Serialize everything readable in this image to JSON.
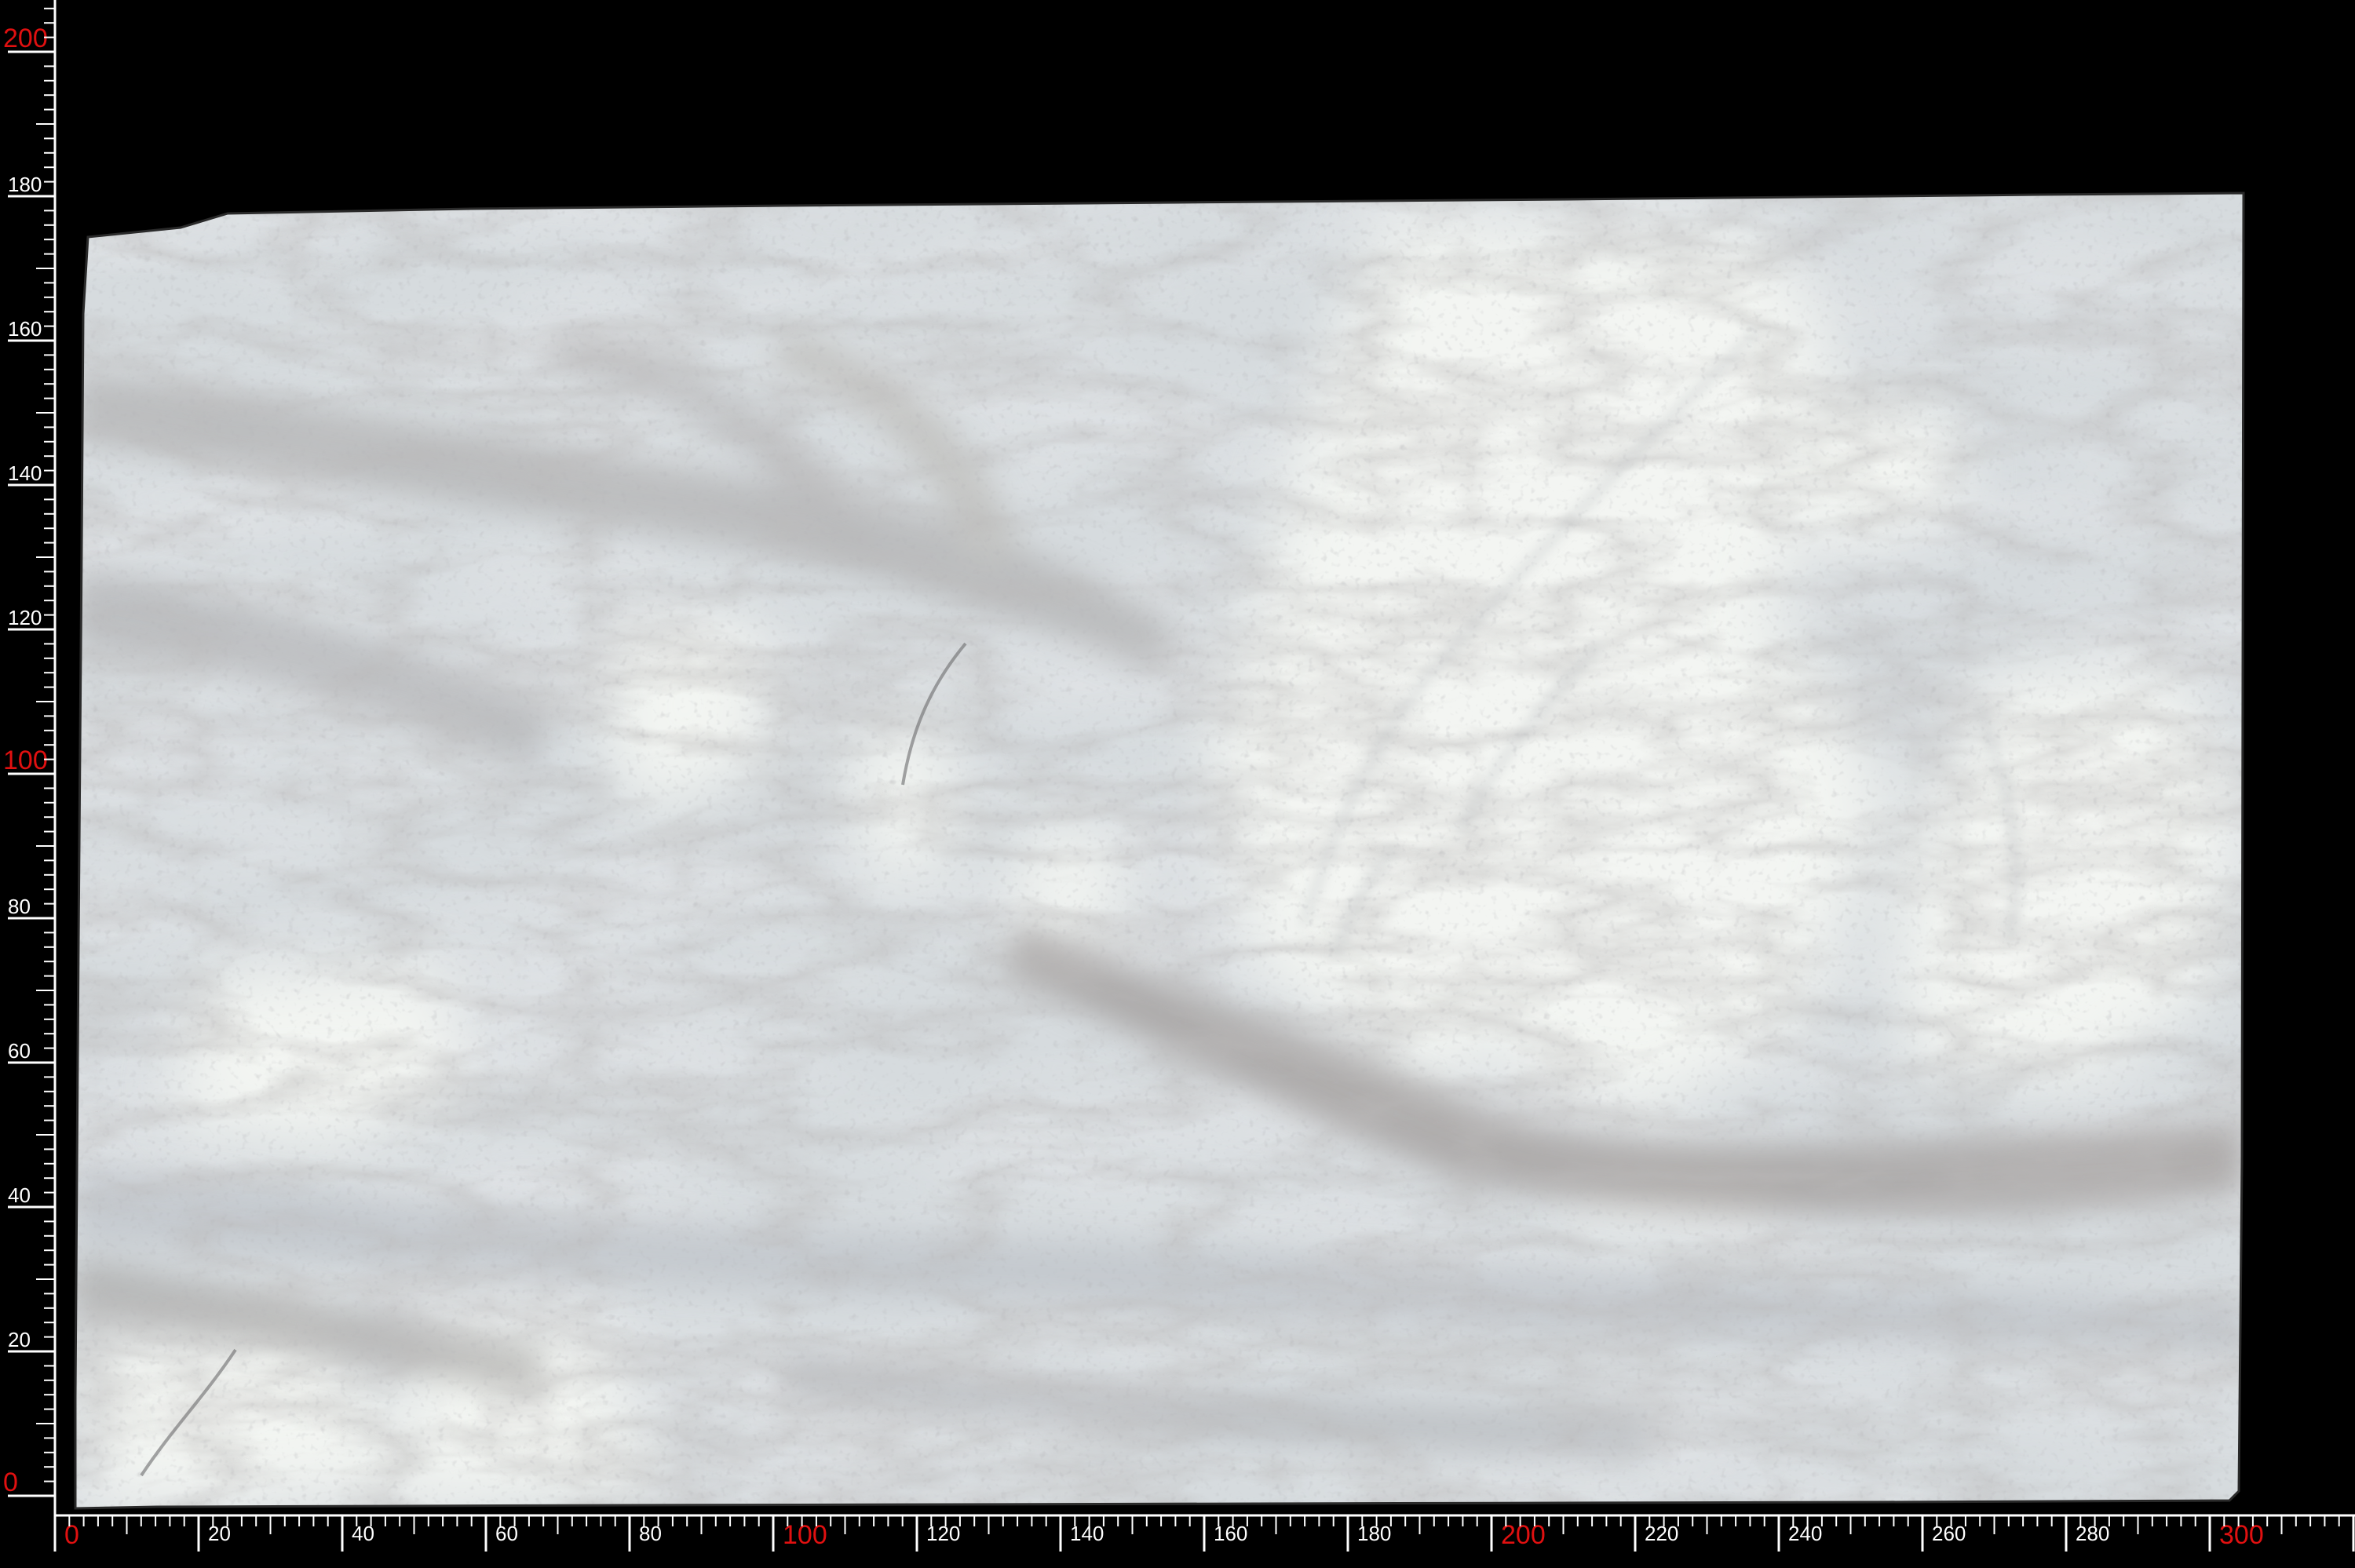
{
  "colors": {
    "background": "#000000",
    "ruler_line": "#ffffff",
    "minor_label": "#ffffff",
    "major_label": "#e01010",
    "stone_base": "#d7dcdf",
    "stone_white": "#f4f6f3",
    "vein_gray": "#9a9a9c",
    "vein_brown": "#8f8784"
  },
  "image": {
    "subject": "marble-slab",
    "shows_grey_brown_veins": true
  },
  "rulers": {
    "x": {
      "min": 0,
      "max": 300,
      "minor_step": 2,
      "label_step": 20,
      "major_values": [
        0,
        100,
        200,
        300
      ],
      "labels": [
        "0",
        "20",
        "40",
        "60",
        "80",
        "100",
        "120",
        "140",
        "160",
        "180",
        "200",
        "220",
        "240",
        "260",
        "280",
        "300"
      ]
    },
    "y": {
      "min": 0,
      "max": 200,
      "minor_step": 2,
      "label_step": 20,
      "major_values": [
        0,
        100,
        200
      ],
      "labels": [
        "0",
        "20",
        "40",
        "60",
        "80",
        "100",
        "120",
        "140",
        "160",
        "180",
        "200"
      ]
    }
  }
}
